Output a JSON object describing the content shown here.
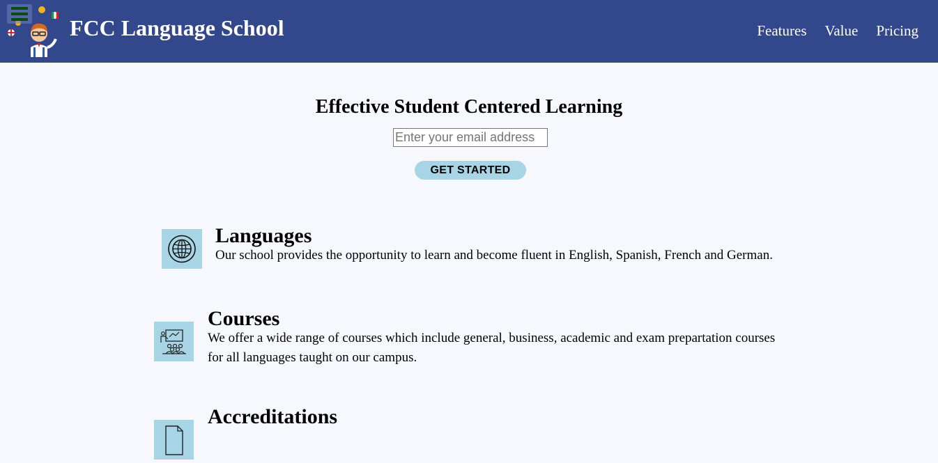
{
  "header": {
    "brand": "FCC Language School",
    "nav": [
      {
        "label": "Features"
      },
      {
        "label": "Value"
      },
      {
        "label": "Pricing"
      }
    ]
  },
  "hero": {
    "title": "Effective Student Centered Learning",
    "email_placeholder": "Enter your email address",
    "cta_label": "GET STARTED"
  },
  "features": [
    {
      "icon": "globe-icon",
      "title": "Languages",
      "description": "Our school provides the opportunity to learn and become fluent in English, Spanish, French and German."
    },
    {
      "icon": "classroom-icon",
      "title": "Courses",
      "description": "We offer a wide range of courses which include general, business, academic and exam prepartation courses for all languages taught on our campus."
    },
    {
      "icon": "certificate-icon",
      "title": "Accreditations",
      "description": ""
    }
  ],
  "colors": {
    "navbar": "#33478c",
    "accent": "#a8d5e5",
    "background": "#f7f8fe"
  }
}
